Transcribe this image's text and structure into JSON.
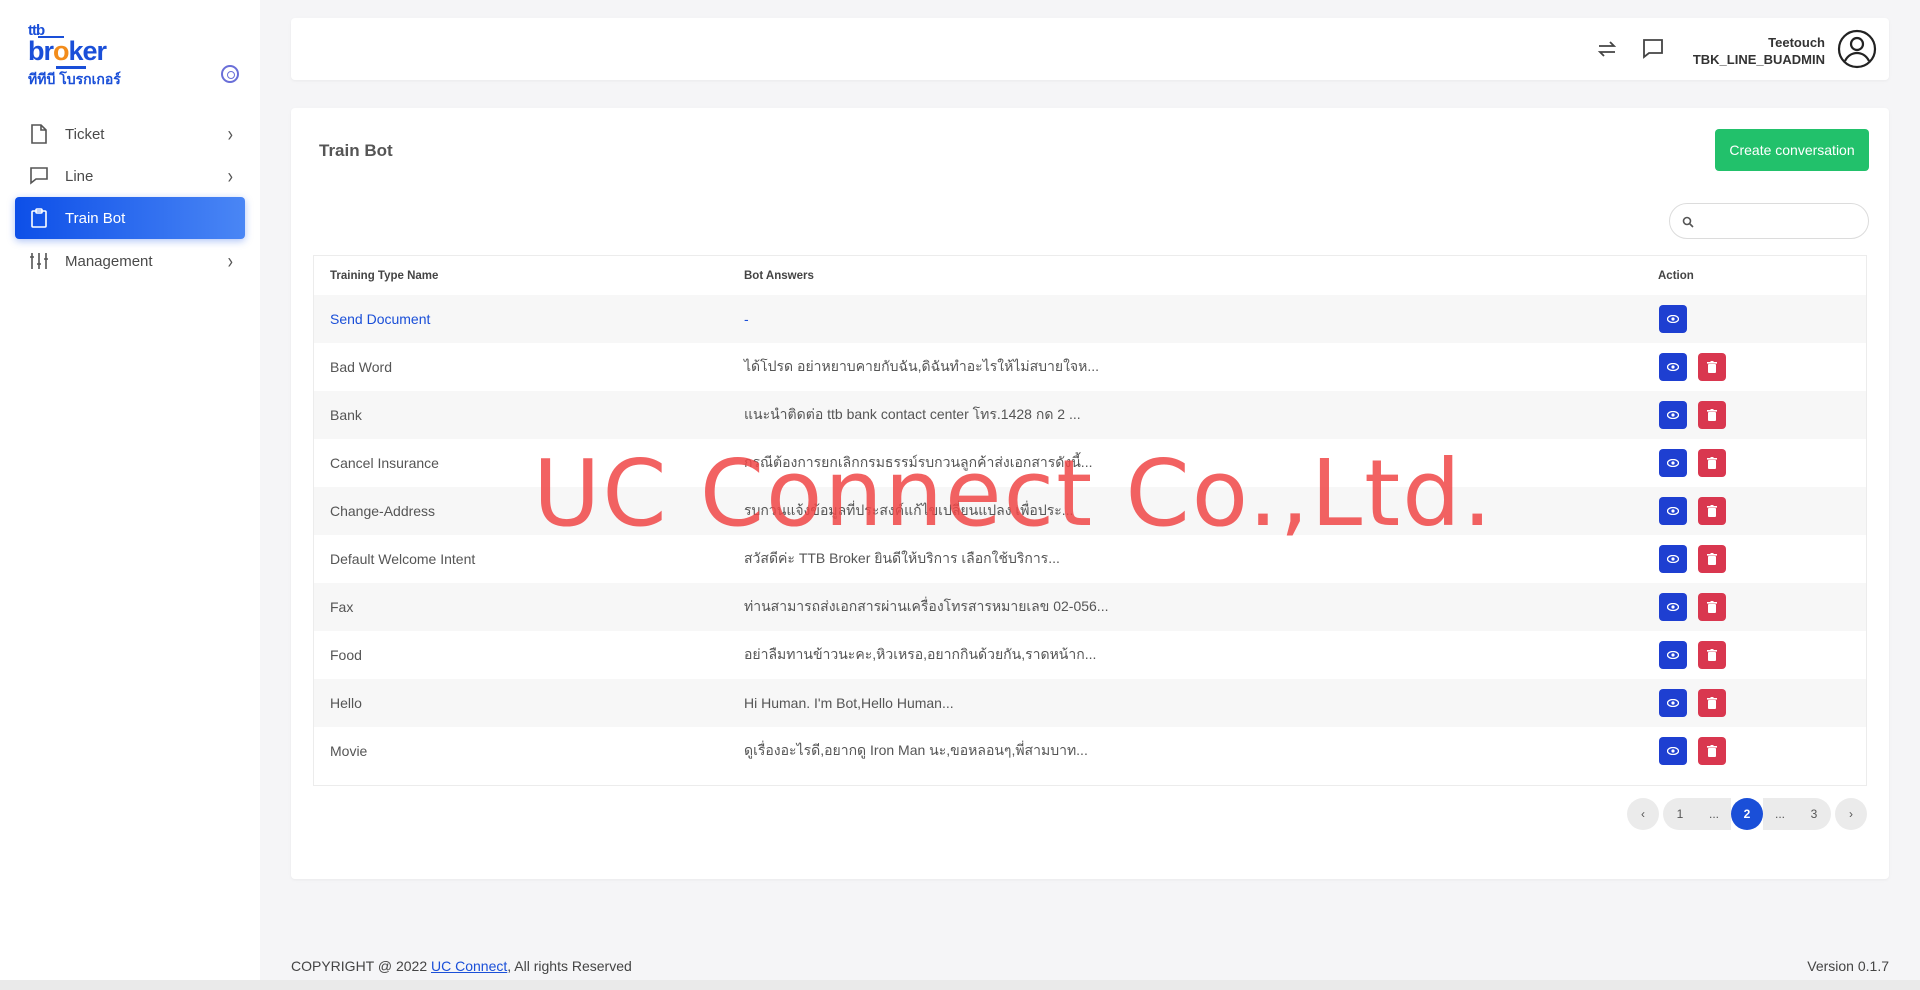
{
  "brand": {
    "logo_line1": "ttb",
    "logo_line2_a": "br",
    "logo_line2_o": "o",
    "logo_line2_b": "ker",
    "logo_line3": "ทีทีบี โบรกเกอร์",
    "accent_color": "#1a4fd8",
    "orange": "#f28c1b"
  },
  "sidebar": {
    "items": [
      {
        "label": "Ticket",
        "icon": "file-icon",
        "has_submenu": true
      },
      {
        "label": "Line",
        "icon": "chat-icon",
        "has_submenu": true
      },
      {
        "label": "Train Bot",
        "icon": "clipboard-icon",
        "active": true
      },
      {
        "label": "Management",
        "icon": "sliders-icon",
        "has_submenu": true
      }
    ]
  },
  "header": {
    "user_name": "Teetouch",
    "user_role": "TBK_LINE_BUADMIN",
    "icons": [
      "sync-icon",
      "message-icon",
      "user-avatar-icon"
    ]
  },
  "main": {
    "title": "Train Bot",
    "create_button": "Create conversation",
    "search_placeholder": "",
    "table": {
      "headers": [
        "Training Type Name",
        "Bot Answers",
        "Action"
      ],
      "rows": [
        {
          "name": "Send Document",
          "answer": "-",
          "deletable": false
        },
        {
          "name": "Bad Word",
          "answer": "ได้โปรด อย่าหยาบคายกับฉัน,ดิฉันทำอะไรให้ไม่สบายใจห...",
          "deletable": true
        },
        {
          "name": "Bank",
          "answer": "แนะนำติดต่อ ttb bank contact center โทร.1428 กด 2 ...",
          "deletable": true
        },
        {
          "name": "Cancel Insurance",
          "answer": "กรณีต้องการยกเลิกกรมธรรม์รบกวนลูกค้าส่งเอกสารดังนี้...",
          "deletable": true
        },
        {
          "name": "Change-Address",
          "answer": "รบกวนแจ้งข้อมูลที่ประสงค์แก้ไขเปลี่ยนแปลง เพื่อประ...",
          "deletable": true
        },
        {
          "name": "Default Welcome Intent",
          "answer": "สวัสดีค่ะ TTB Broker ยินดีให้บริการ เลือกใช้บริการ...",
          "deletable": true
        },
        {
          "name": "Fax",
          "answer": "ท่านสามารถส่งเอกสารผ่านเครื่องโทรสารหมายเลข 02-056...",
          "deletable": true
        },
        {
          "name": "Food",
          "answer": "อย่าลืมทานข้าวนะคะ,หิวเหรอ,อยากกินด้วยกัน,ราดหน้าก...",
          "deletable": true
        },
        {
          "name": "Hello",
          "answer": "Hi Human. I'm Bot,Hello Human...",
          "deletable": true
        },
        {
          "name": "Movie",
          "answer": "ดูเรื่องอะไรดี,อยากดู Iron Man นะ,ขอหลอนๆ,พี่สามบาท...",
          "deletable": true
        }
      ]
    },
    "pagination": {
      "prev": "‹",
      "pages": [
        "1",
        "...",
        "2",
        "...",
        "3"
      ],
      "current": "2",
      "next": "›"
    }
  },
  "watermark": "UC Connect Co.,Ltd.",
  "footer": {
    "copyright_prefix": "COPYRIGHT @ 2022 ",
    "company_link": "UC Connect",
    "copyright_suffix": ", All rights Reserved",
    "version": "Version 0.1.7"
  },
  "colors": {
    "active_nav_start": "#0d4fe8",
    "active_nav_end": "#4a86f5",
    "create_button": "#22c16b",
    "view_button": "#1e3fd1",
    "delete_button": "#d9374f"
  }
}
